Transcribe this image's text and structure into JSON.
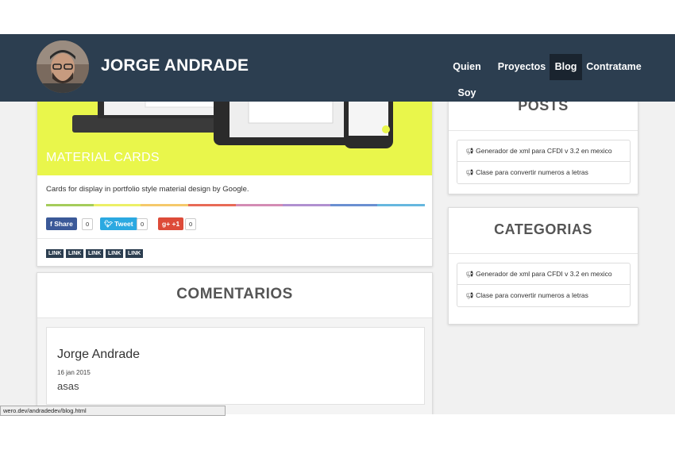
{
  "brand": {
    "name": "JORGE ANDRADE"
  },
  "nav": {
    "items": [
      {
        "label": "Quien Soy"
      },
      {
        "label": "Proyectos"
      },
      {
        "label": "Blog",
        "active": true
      },
      {
        "label": "Contratame"
      }
    ]
  },
  "post": {
    "title": "MATERIAL CARDS",
    "description": "Cards for display in portfolio style material design by Google.",
    "accent_color": "#e9f64b",
    "color_bar": [
      "#a5cc5b",
      "#ecf067",
      "#f5c96b",
      "#e86a57",
      "#d38cb4",
      "#b090d0",
      "#6a8fd1",
      "#66b7df"
    ],
    "share": [
      {
        "label": "f Share",
        "count": "0",
        "color": "#3b5998"
      },
      {
        "label": "Tweet",
        "count": "0",
        "color": "#2ba9e1"
      },
      {
        "label": "g+ +1",
        "count": "0",
        "color": "#dd4b39"
      }
    ],
    "tags": [
      "LINK",
      "LINK",
      "LINK",
      "LINK",
      "LINK"
    ]
  },
  "comments": {
    "title": "COMENTARIOS",
    "items": [
      {
        "author": "Jorge Andrade",
        "date": "16 jan 2015",
        "body": "asas"
      }
    ]
  },
  "sidebar": {
    "posts": {
      "title": "POSTS",
      "items": [
        {
          "label": "Generador de xml para CFDI v 3.2 en mexico"
        },
        {
          "label": "Clase para convertir numeros a letras"
        }
      ]
    },
    "categories": {
      "title": "CATEGORIAS",
      "items": [
        {
          "label": "Generador de xml para CFDI v 3.2 en mexico"
        },
        {
          "label": "Clase para convertir numeros a letras"
        }
      ]
    }
  },
  "statusbar": {
    "url": "wero.dev/andradedev/blog.html"
  },
  "colors": {
    "navbar": "#2c3e50",
    "tag": "#2c3e50"
  }
}
